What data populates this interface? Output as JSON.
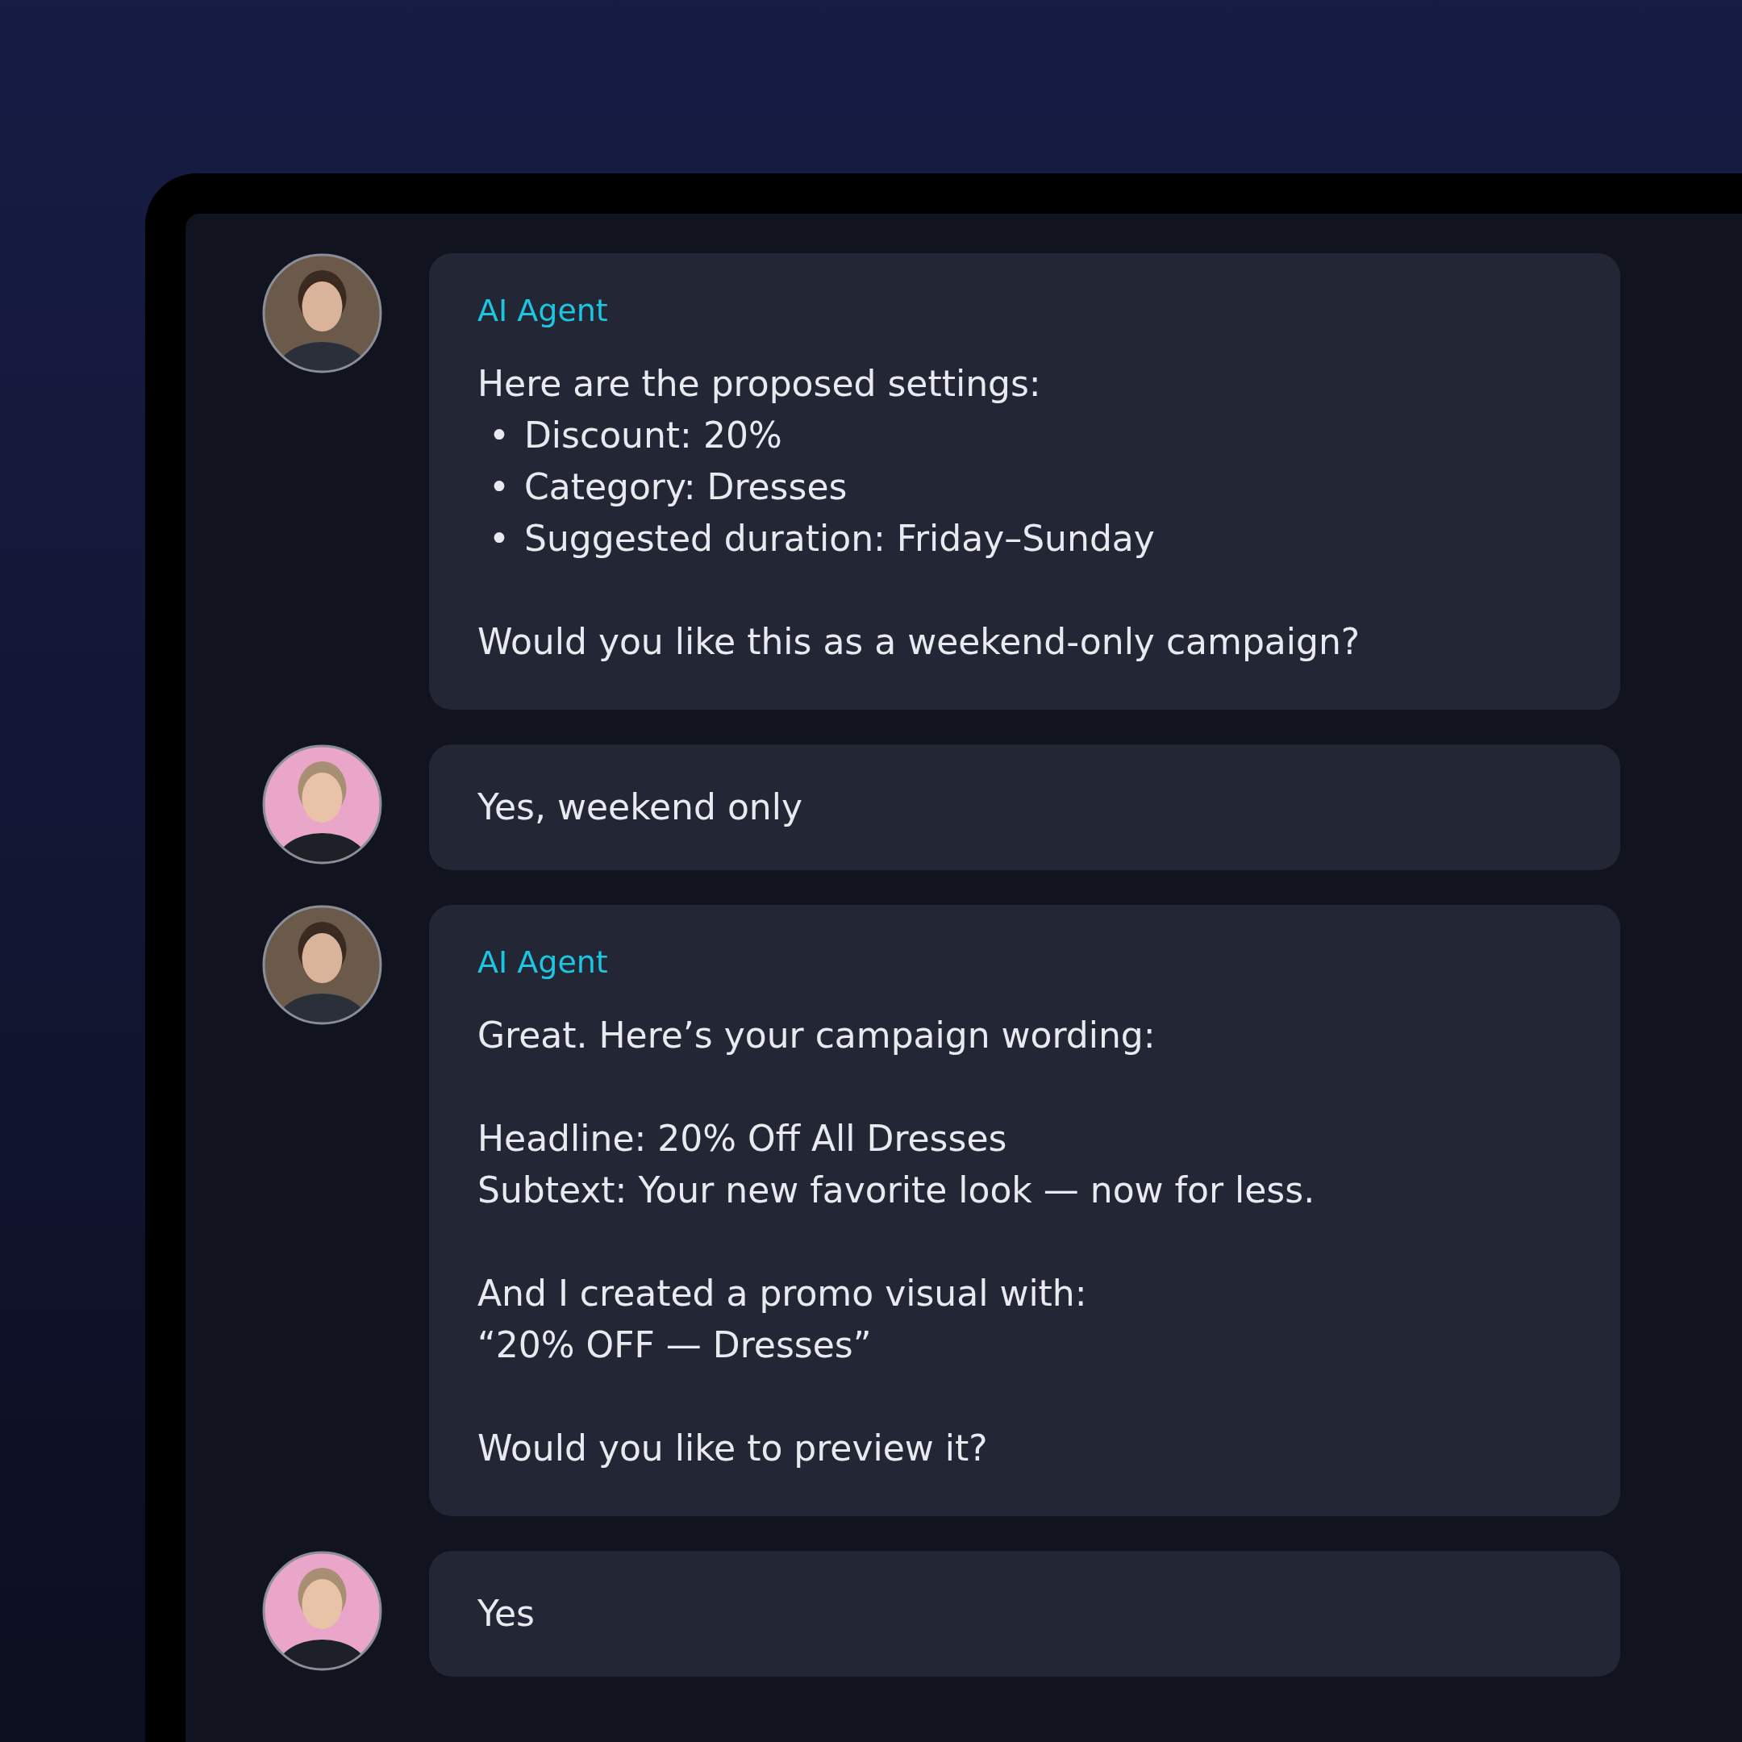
{
  "messages": [
    {
      "kind": "agent",
      "label": "AI Agent",
      "paragraphs": [
        [
          {
            "kind": "text",
            "text": "Here are the proposed settings:"
          },
          {
            "kind": "bullet",
            "marker": "•",
            "text": "Discount: 20%"
          },
          {
            "kind": "bullet",
            "marker": "•",
            "text": "Category: Dresses"
          },
          {
            "kind": "bullet",
            "marker": "•",
            "text": "Suggested duration: Friday–Sunday"
          }
        ],
        [
          {
            "kind": "text",
            "text": "Would you like this as a weekend-only campaign?"
          }
        ]
      ]
    },
    {
      "kind": "user",
      "paragraphs": [
        [
          {
            "kind": "text",
            "text": "Yes, weekend only"
          }
        ]
      ]
    },
    {
      "kind": "agent",
      "label": "AI Agent",
      "paragraphs": [
        [
          {
            "kind": "text",
            "text": "Great. Here’s your campaign wording:"
          }
        ],
        [
          {
            "kind": "text",
            "text": "Headline: 20% Off All Dresses"
          },
          {
            "kind": "text",
            "text": "Subtext: Your new favorite look — now for less."
          }
        ],
        [
          {
            "kind": "text",
            "text": "And I created a promo visual with:"
          },
          {
            "kind": "text",
            "text": "“20% OFF — Dresses”"
          }
        ],
        [
          {
            "kind": "text",
            "text": "Would you like to preview it?"
          }
        ]
      ]
    },
    {
      "kind": "user",
      "paragraphs": [
        [
          {
            "kind": "text",
            "text": "Yes"
          }
        ]
      ]
    }
  ]
}
